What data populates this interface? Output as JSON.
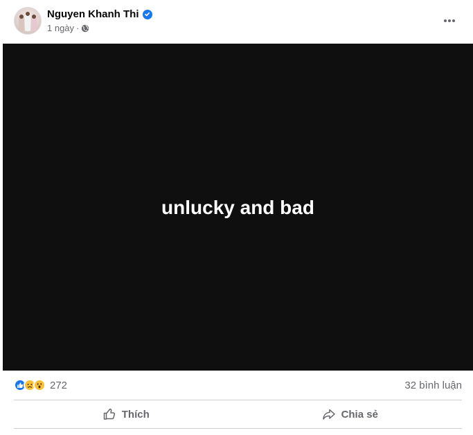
{
  "post": {
    "author": "Nguyen Khanh Thi",
    "time": "1 ngày",
    "separator": "·",
    "media_text": "unlucky and bad",
    "reaction_count": "272",
    "comments_label": "32 bình luận"
  },
  "actions": {
    "like_label": "Thích",
    "share_label": "Chia sẻ"
  },
  "icons": {
    "verified": "verified-badge-icon",
    "audience": "globe-icon",
    "more": "more-horizontal-icon",
    "reactions": [
      "like-reaction-icon",
      "sad-reaction-icon",
      "wow-reaction-icon"
    ],
    "like": "thumbs-up-icon",
    "share": "share-arrow-icon"
  },
  "colors": {
    "accent": "#1877f2",
    "secondary_text": "#65676b",
    "media_background": "#0f0f0f"
  }
}
